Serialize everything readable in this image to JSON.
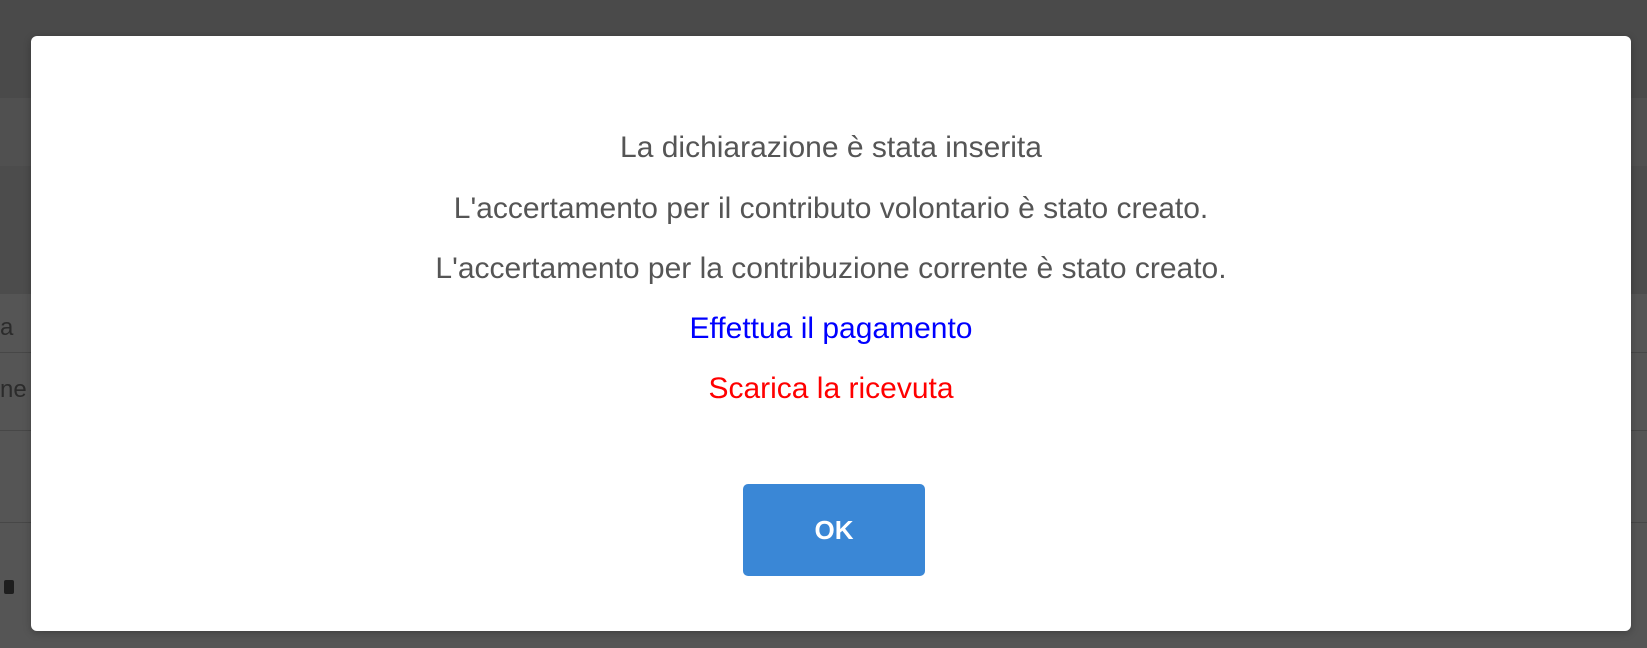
{
  "background": {
    "fragment_1": "a",
    "fragment_2": "ne"
  },
  "dialog": {
    "messages": [
      "La dichiarazione è stata inserita",
      "L'accertamento per il contributo volontario è stato creato.",
      "L'accertamento per la contribuzione corrente è stato creato."
    ],
    "pay_link": "Effettua il pagamento",
    "receipt_link": "Scarica la ricevuta",
    "ok_label": "OK"
  },
  "colors": {
    "overlay": "#4a4a4a",
    "message_text": "#555555",
    "pay_link": "#0000ff",
    "receipt_link": "#ff0000",
    "ok_button": "#3a87d6"
  }
}
